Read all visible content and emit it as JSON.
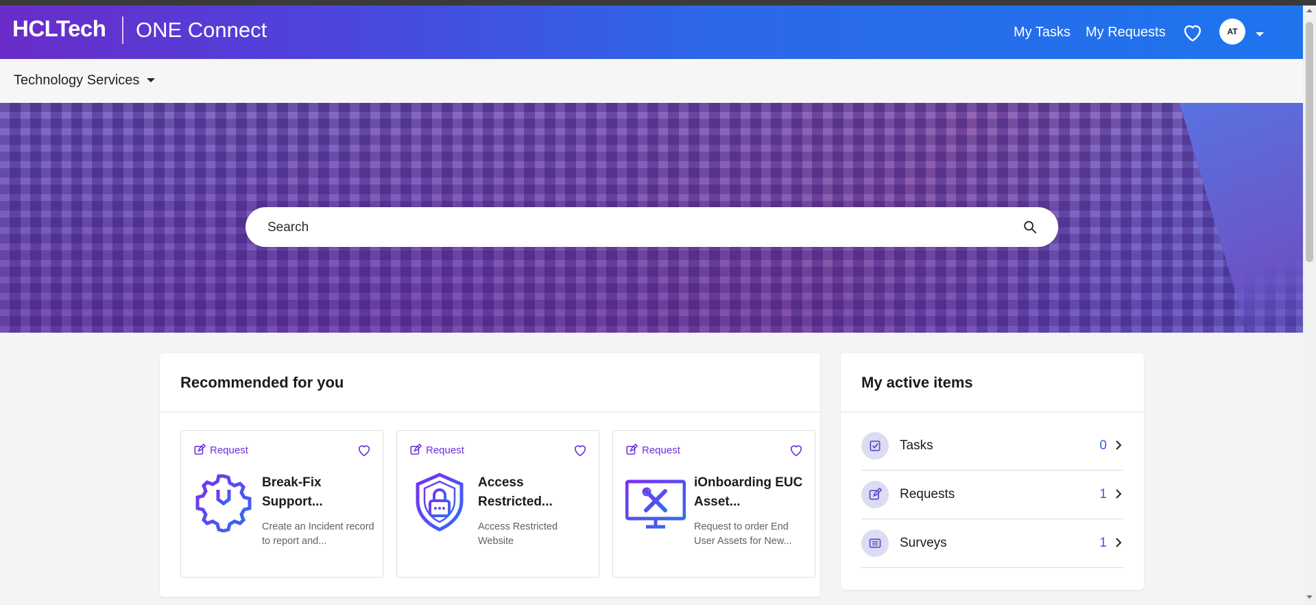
{
  "header": {
    "brand": "HCLTech",
    "product": "ONE Connect",
    "nav": {
      "my_tasks": "My Tasks",
      "my_requests": "My Requests"
    },
    "avatar_initials": "AT"
  },
  "subnav": {
    "menu_label": "Technology Services"
  },
  "search": {
    "placeholder": "Search"
  },
  "recommended": {
    "title": "Recommended for you",
    "items": [
      {
        "badge": "Request",
        "title": "Break-Fix Support...",
        "description": "Create an Incident record to report and...",
        "icon": "gear-wrench-icon"
      },
      {
        "badge": "Request",
        "title": "Access Restricted...",
        "description": "Access Restricted Website",
        "icon": "shield-lock-icon"
      },
      {
        "badge": "Request",
        "title": "iOnboarding EUC Asset...",
        "description": "Request to order End User Assets for New...",
        "icon": "monitor-tools-icon"
      }
    ]
  },
  "active_items": {
    "title": "My active items",
    "rows": [
      {
        "label": "Tasks",
        "count": "0",
        "icon": "checkbox-icon"
      },
      {
        "label": "Requests",
        "count": "1",
        "icon": "edit-icon"
      },
      {
        "label": "Surveys",
        "count": "1",
        "icon": "list-icon"
      }
    ]
  },
  "colors": {
    "accent_purple": "#6c2bd9",
    "count_blue": "#3b5bdb",
    "header_start": "#6a2cc9",
    "header_end": "#1f74ee"
  }
}
